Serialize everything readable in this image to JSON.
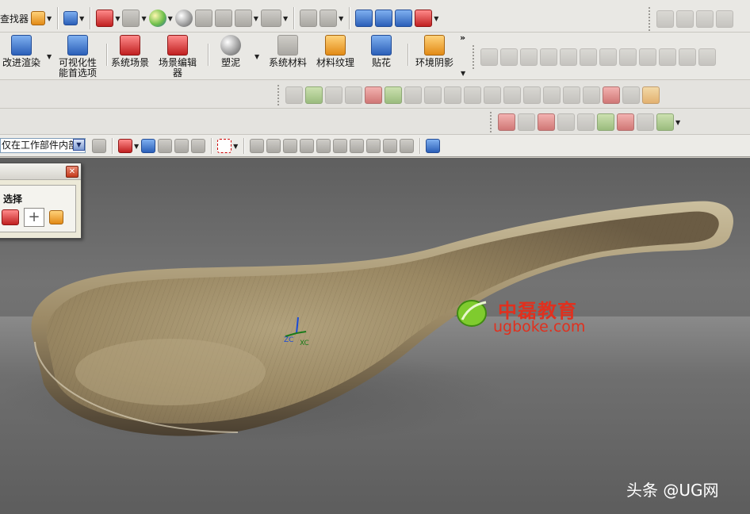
{
  "toolbar1": {
    "find_label": "查找器"
  },
  "toolbar2": {
    "buttons": [
      {
        "label": "改进渲染"
      },
      {
        "label": "可视化性\n能首选项"
      },
      {
        "label": "系统场景"
      },
      {
        "label": "场景编辑\n器"
      },
      {
        "label": "塑泥"
      },
      {
        "label": "系统材料"
      },
      {
        "label": "材料纹理"
      },
      {
        "label": "贴花"
      },
      {
        "label": "环境阴影"
      }
    ],
    "overflow": "»"
  },
  "selection_bar": {
    "filter_value": "仅在工作部件内部"
  },
  "dialog": {
    "section_label": "选择",
    "close": "✕",
    "plus": "+"
  },
  "viewport": {
    "triad_labels": [
      "ZC",
      "XC"
    ]
  },
  "watermark": {
    "name": "中磊教育",
    "url": "ugboke.com",
    "credit": "头条 @UG网"
  },
  "colors": {
    "viewport_bg": "#6d6d6d",
    "watermark": "#e0301e",
    "spoon_wood": "#a08f6b"
  }
}
